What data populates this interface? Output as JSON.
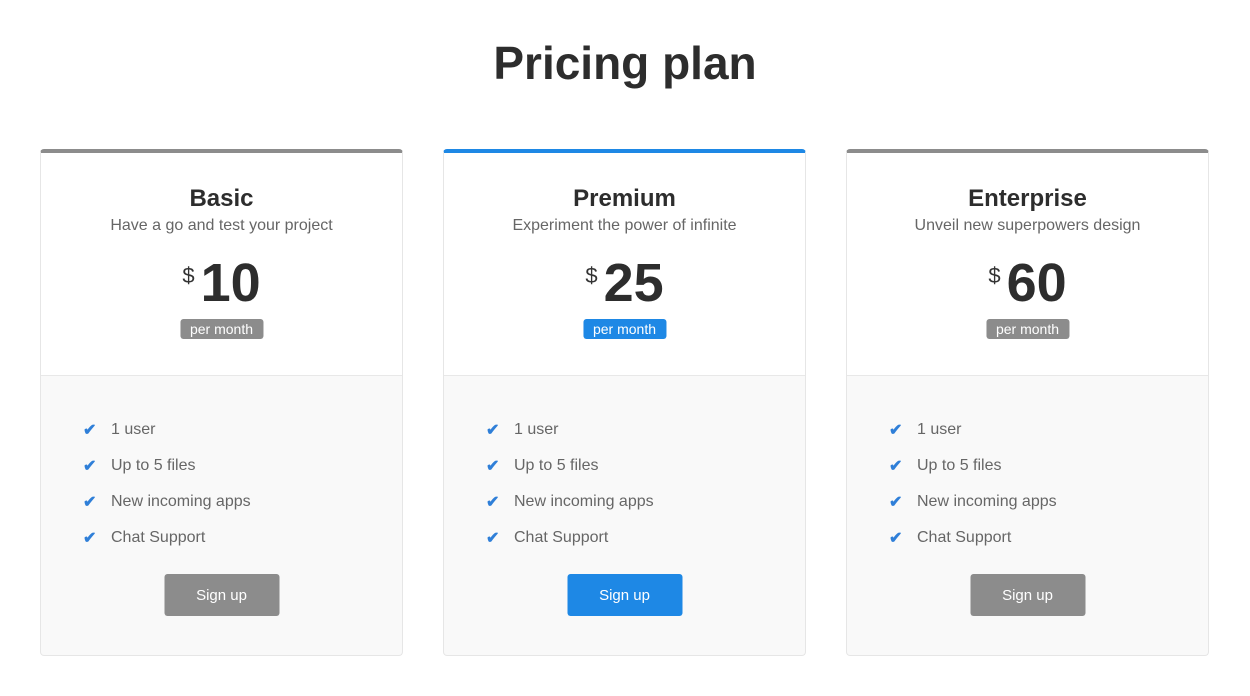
{
  "page": {
    "title": "Pricing plan"
  },
  "plans": [
    {
      "name": "Basic",
      "subtitle": "Have a go and test your project",
      "currency": "$",
      "price": "10",
      "period": "per month",
      "features": [
        "1 user",
        "Up to 5 files",
        "New incoming apps",
        "Chat Support"
      ],
      "cta": "Sign up",
      "accent": "#8c8c8c"
    },
    {
      "name": "Premium",
      "subtitle": "Experiment the power of infinite",
      "currency": "$",
      "price": "25",
      "period": "per month",
      "features": [
        "1 user",
        "Up to 5 files",
        "New incoming apps",
        "Chat Support"
      ],
      "cta": "Sign up",
      "accent": "#1e88e5"
    },
    {
      "name": "Enterprise",
      "subtitle": "Unveil new superpowers design",
      "currency": "$",
      "price": "60",
      "period": "per month",
      "features": [
        "1 user",
        "Up to 5 files",
        "New incoming apps",
        "Chat Support"
      ],
      "cta": "Sign up",
      "accent": "#8c8c8c"
    }
  ]
}
